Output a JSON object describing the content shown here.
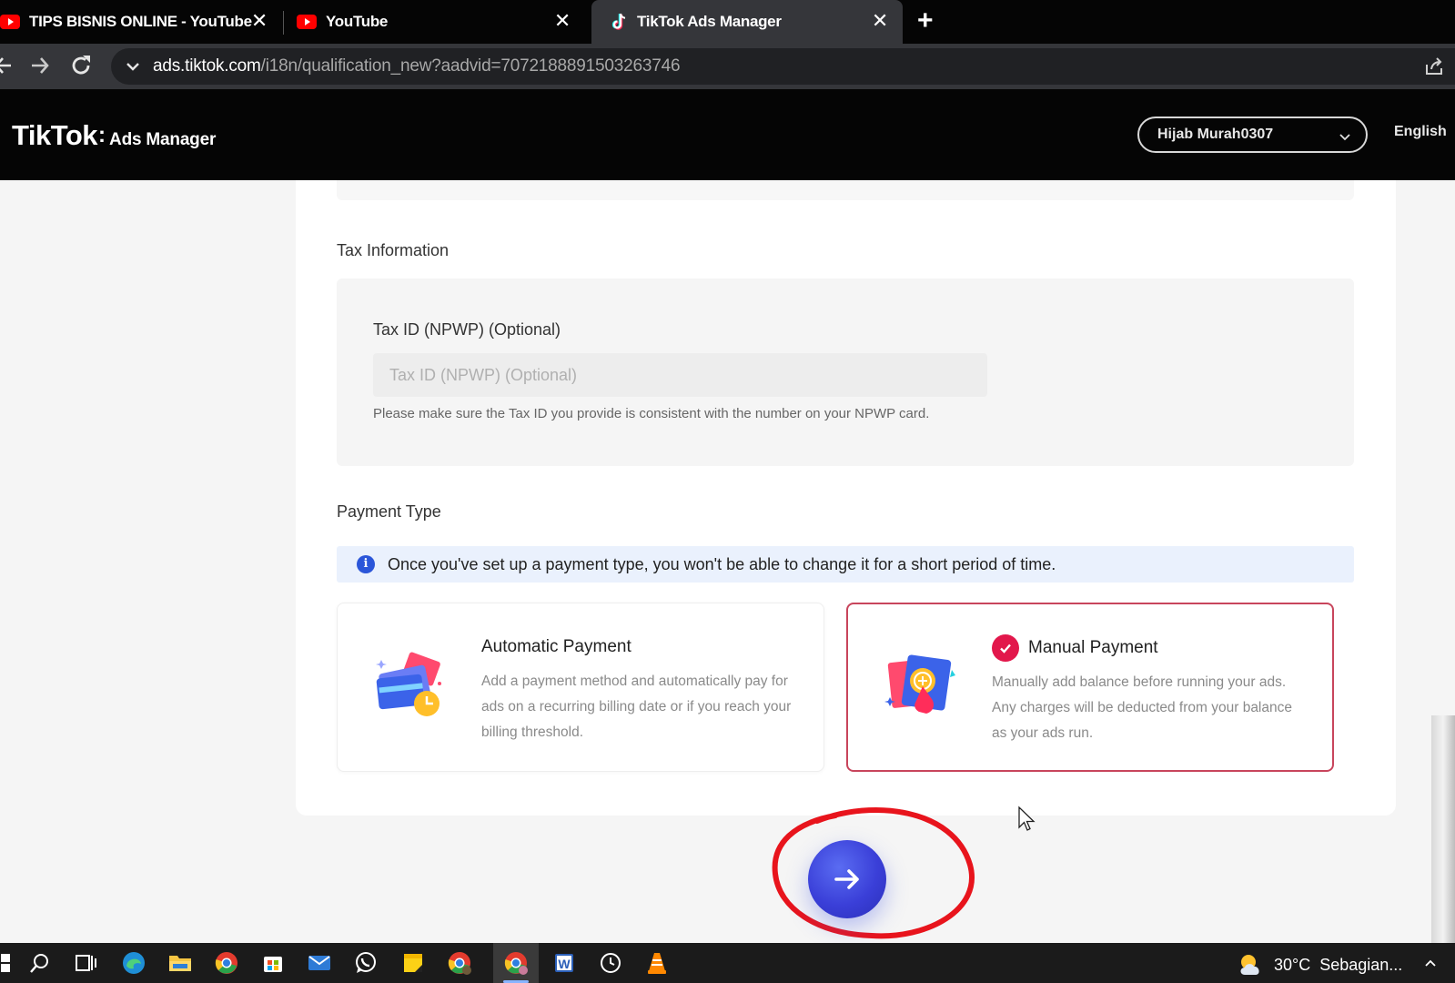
{
  "browser": {
    "tabs": [
      {
        "title": "TIPS BISNIS ONLINE - YouTube",
        "icon": "youtube-icon"
      },
      {
        "title": "YouTube",
        "icon": "youtube-icon"
      },
      {
        "title": "TikTok Ads Manager",
        "icon": "tiktok-icon",
        "active": true
      }
    ],
    "close_glyph": "✕",
    "new_tab_glyph": "+",
    "url_host": "ads.tiktok.com",
    "url_path": "/i18n/qualification_new?aadvid=7072188891503263746"
  },
  "header": {
    "logo_main": "TikTok",
    "logo_dot": ":",
    "logo_sub": "Ads Manager",
    "account_name": "Hijab Murah0307",
    "language": "English"
  },
  "tax": {
    "section_title": "Tax Information",
    "field_label": "Tax ID (NPWP) (Optional)",
    "placeholder": "Tax ID (NPWP) (Optional)",
    "value": "",
    "hint": "Please make sure the Tax ID you provide is consistent with the number on your NPWP card."
  },
  "payment": {
    "section_title": "Payment Type",
    "notice": "Once you've set up a payment type, you won't be able to change it for a short period of time.",
    "options": [
      {
        "title": "Automatic Payment",
        "description": "Add a payment method and automatically pay for ads on a recurring billing date or if you reach your billing threshold.",
        "selected": false
      },
      {
        "title": "Manual Payment",
        "description": "Manually add balance before running your ads. Any charges will be deducted from your balance as your ads run.",
        "selected": true
      }
    ]
  },
  "taskbar": {
    "apps": [
      "windows-start",
      "search-icon",
      "task-view-icon",
      "edge-icon",
      "file-explorer-icon",
      "chrome-icon",
      "store-icon",
      "mail-icon",
      "whatsapp-icon",
      "sticky-notes-icon",
      "chrome-profile-icon",
      "chrome-active-icon",
      "word-icon",
      "clock-icon",
      "vlc-icon"
    ],
    "temperature": "30°C",
    "weather_text": "Sebagian..."
  },
  "colors": {
    "accent_next": "#3a3fd8",
    "selected_border": "#c8455c",
    "check_badge": "#e2174b",
    "annotation": "#e8141c",
    "info_bg": "#eaf1fd"
  }
}
